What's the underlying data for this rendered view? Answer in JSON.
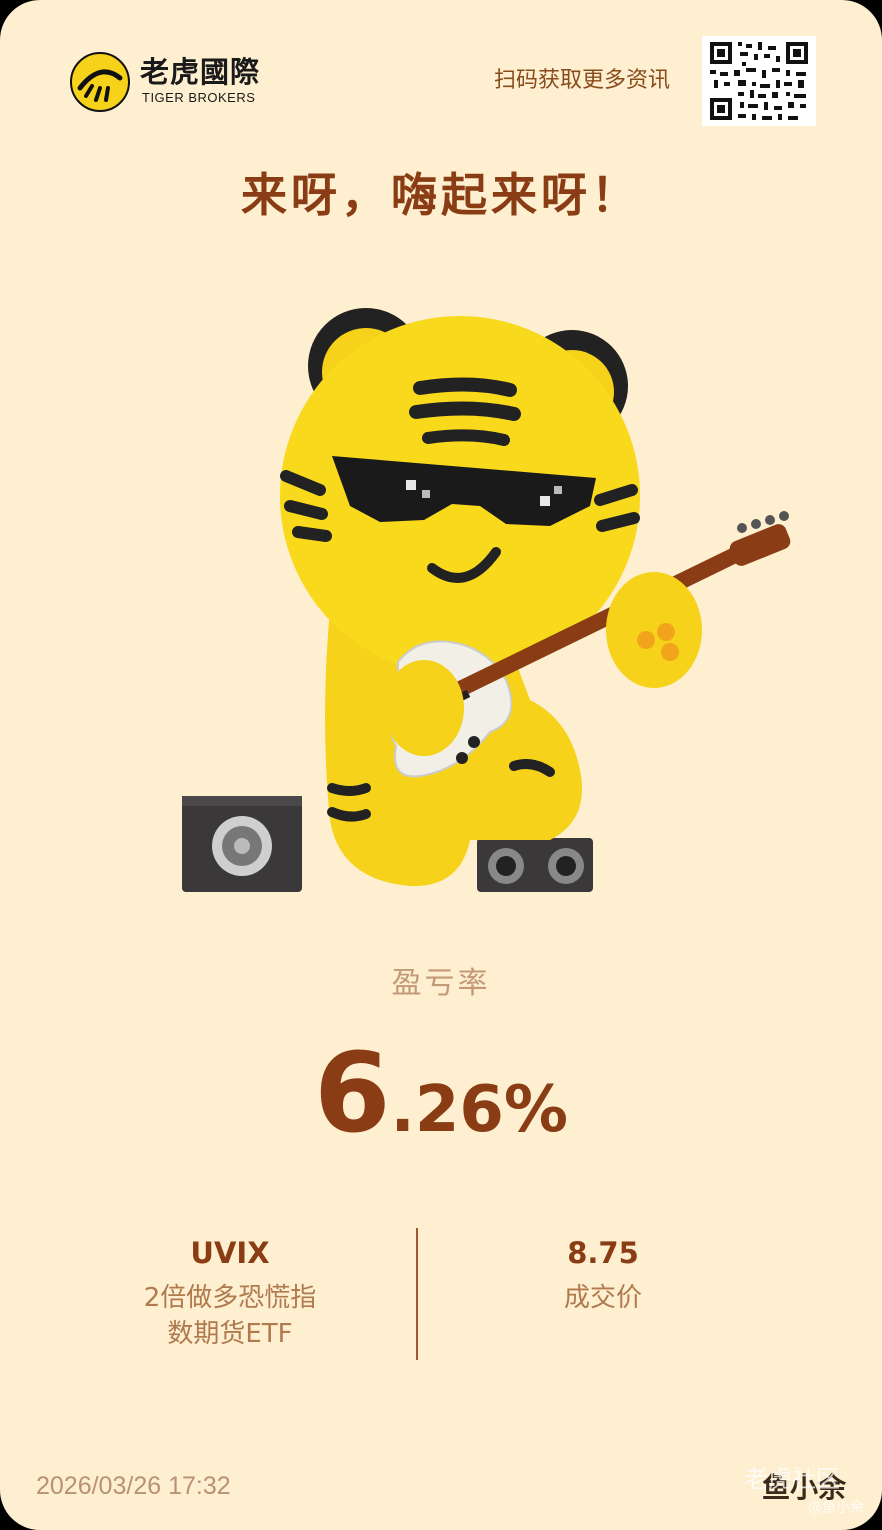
{
  "brand": {
    "name_cn": "老虎國際",
    "name_en": "TIGER BROKERS"
  },
  "header": {
    "scan_text": "扫码获取更多资讯"
  },
  "headline": "来呀，嗨起来呀！",
  "metric": {
    "label": "盈亏率",
    "value_int": "6",
    "value_frac": ".26%"
  },
  "stock": {
    "symbol": "UVIX",
    "name": "2倍做多恐慌指\n数期货ETF"
  },
  "trade": {
    "price": "8.75",
    "price_label": "成交价"
  },
  "footer": {
    "timestamp": "2026/03/26 17:32",
    "username": "鱼小余"
  },
  "watermark": {
    "community": "老虎社区",
    "handle": "@鱼小余"
  },
  "colors": {
    "background": "#fdefcf",
    "accent": "#8a3d14",
    "muted": "#b07a4e",
    "tiger_yellow": "#f6d21b"
  },
  "icons": [
    "tiger-logo-icon",
    "qr-code-icon",
    "tiger-mascot-illustration"
  ]
}
